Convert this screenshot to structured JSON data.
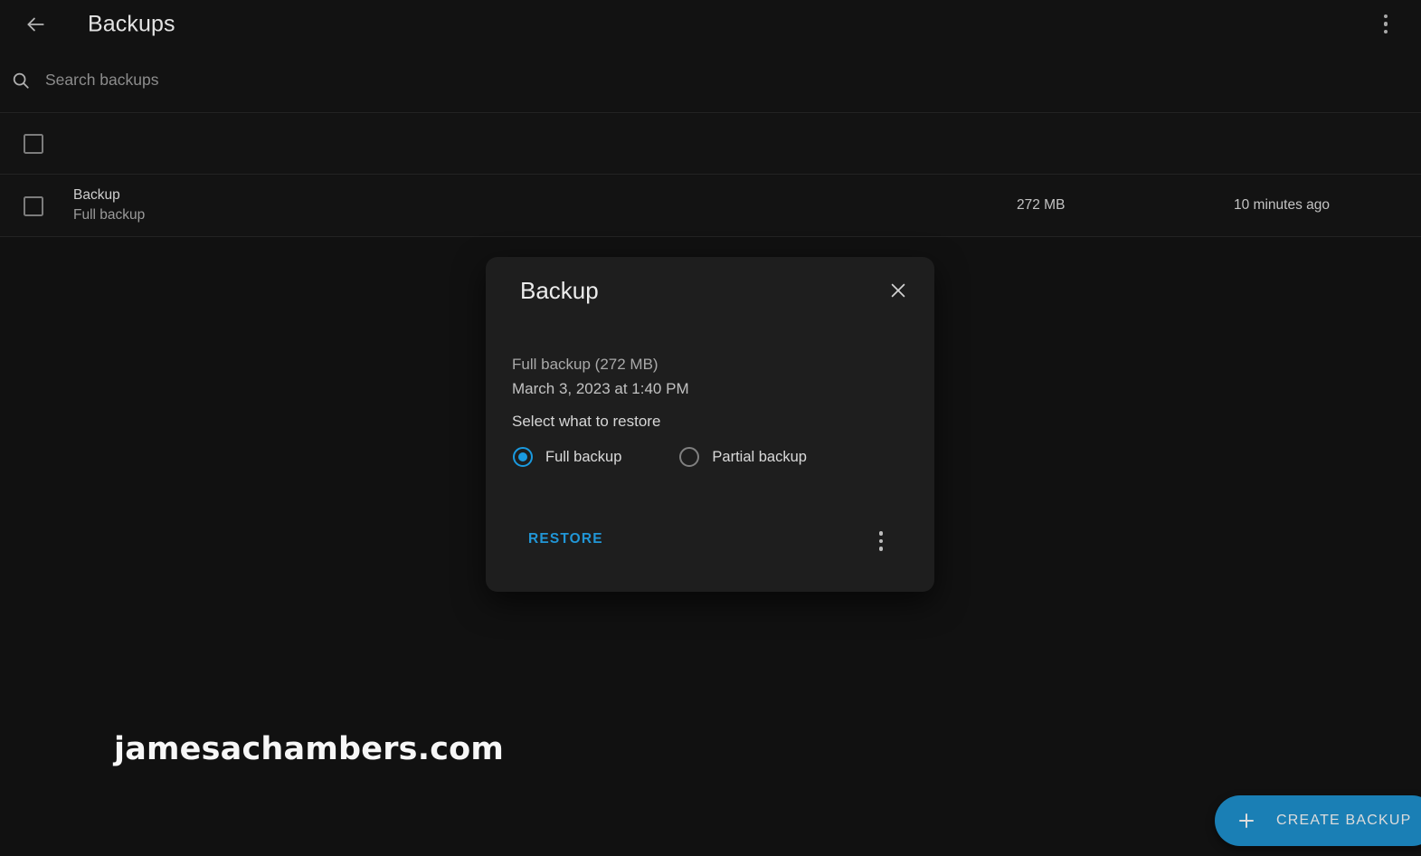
{
  "appbar": {
    "title": "Backups",
    "back_icon": "arrow-left-icon",
    "overflow_icon": "more-vertical-icon"
  },
  "search": {
    "placeholder": "Search backups",
    "value": "",
    "icon": "search-icon"
  },
  "list": {
    "select_all_checked": false,
    "rows": [
      {
        "checked": false,
        "title": "Backup",
        "subtitle": "Full backup",
        "size": "272 MB",
        "time": "10 minutes ago"
      }
    ]
  },
  "dialog": {
    "title": "Backup",
    "close_icon": "close-icon",
    "summary": "Full backup (272 MB)",
    "datetime": "March 3, 2023 at 1:40 PM",
    "prompt": "Select what to restore",
    "radio_options": [
      {
        "label": "Full backup",
        "selected": true
      },
      {
        "label": "Partial backup",
        "selected": false
      }
    ],
    "restore_label": "RESTORE",
    "overflow_icon": "more-vertical-icon"
  },
  "watermark": {
    "text": "jamesachambers.com"
  },
  "fab": {
    "label": "CREATE BACKUP",
    "icon": "plus-icon"
  },
  "colors": {
    "background": "#111111",
    "surface": "#131313",
    "dialog_surface": "#1e1e1e",
    "accent_blue": "#2196d6",
    "radio_blue": "#1a9ae0",
    "fab_blue": "#1a7fb5",
    "divider": "#242424",
    "text_primary": "#e3e3e3",
    "text_secondary": "#9b9b9b"
  }
}
